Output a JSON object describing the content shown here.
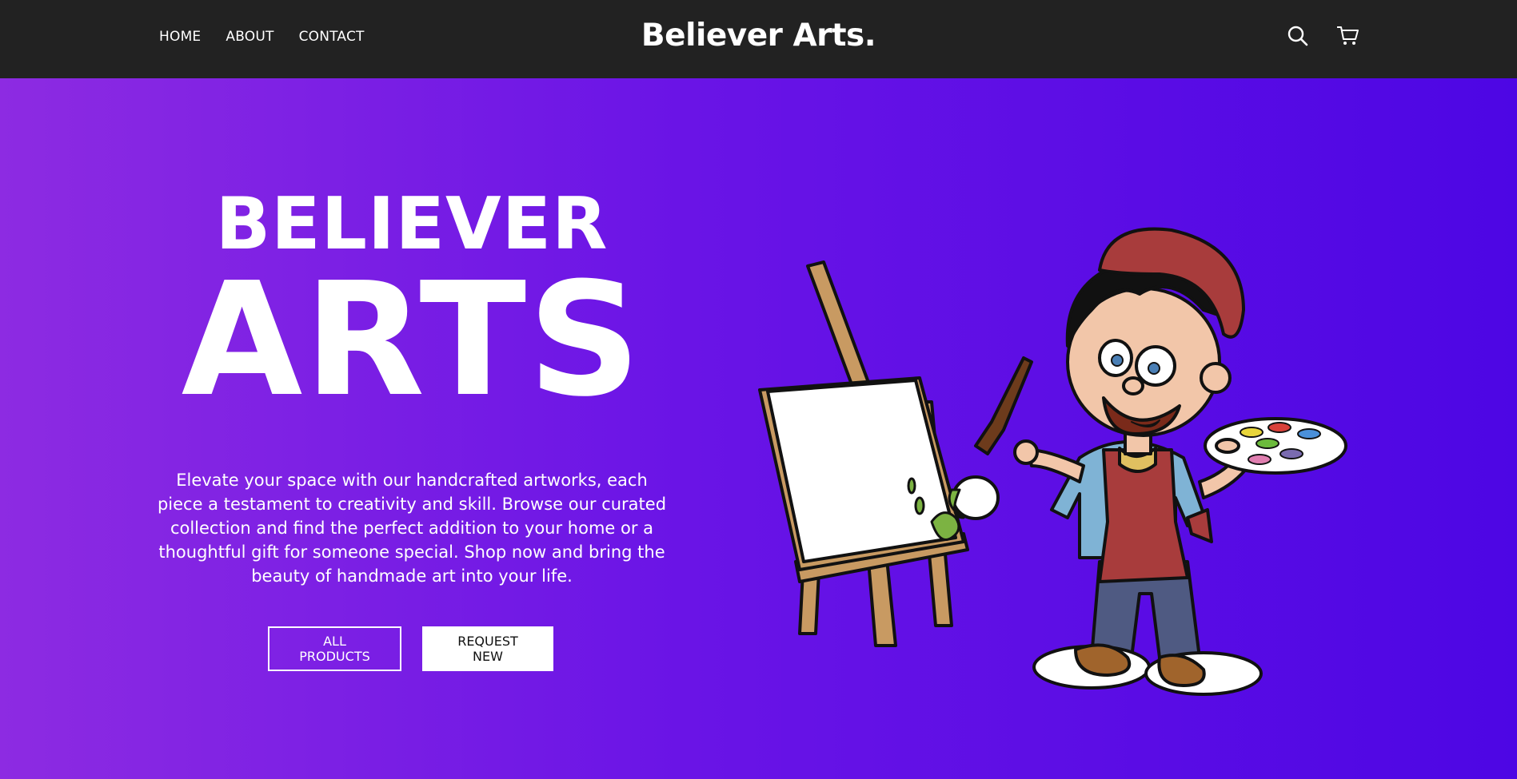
{
  "nav": {
    "links": [
      "HOME",
      "ABOUT",
      "CONTACT"
    ],
    "brand": "Believer Arts.",
    "icons": [
      "search-icon",
      "cart-icon"
    ]
  },
  "hero": {
    "title_line1": "BELIEVER",
    "title_line2": "ARTS",
    "description": "Elevate your space with our handcrafted artworks, each piece a testament to creativity and skill. Browse our curated collection and find the perfect addition to your home or a thoughtful gift for someone special. Shop now and bring the beauty of handmade art into your life.",
    "buttons": {
      "all_products": "ALL PRODUCTS",
      "request_new": "REQUEST NEW"
    },
    "illustration": "cartoon-painter-with-easel"
  },
  "colors": {
    "navbar": "#222222",
    "gradient_start": "#8d2be2",
    "gradient_end": "#4d06e4",
    "text": "#ffffff"
  }
}
